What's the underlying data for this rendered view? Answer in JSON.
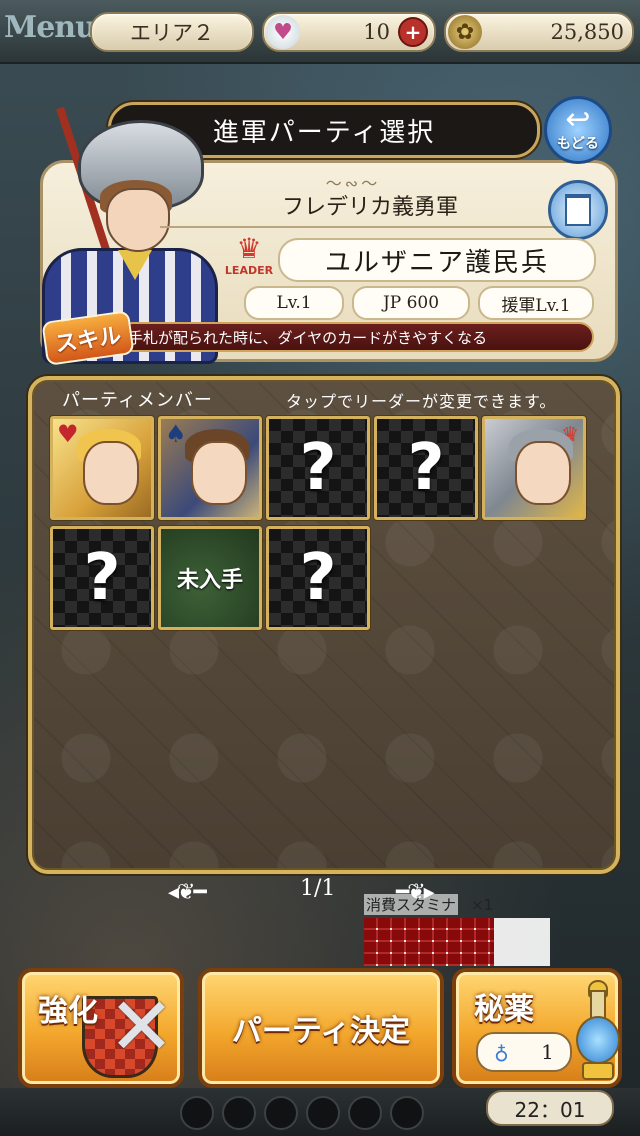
{
  "topbar": {
    "menu_label": "Menu",
    "area_label": "エリア２",
    "hearts_value": "10",
    "coins_value": "25,850"
  },
  "header": {
    "title": "進軍パーティ選択",
    "back_label": "もどる",
    "ornament": "～∾～",
    "party_name": "フレデリカ義勇軍",
    "leader_badge": "LEADER",
    "leader_name": "ユルザニア護民兵",
    "level": "Lv.1",
    "jp": "JP  600",
    "support_level": "援軍Lv.1",
    "skill_tag": "スキル",
    "skill_desc": "手札が配られた時に、ダイヤのカードがきやすくなる"
  },
  "members": {
    "heading": "パーティメンバー",
    "hint": "タップでリーダーが変更できます。",
    "slots": [
      {
        "type": "character",
        "suit": "♥"
      },
      {
        "type": "character",
        "suit": "♠"
      },
      {
        "type": "empty",
        "label": "?"
      },
      {
        "type": "empty",
        "label": "?"
      },
      {
        "type": "leader",
        "suit": "♛"
      },
      {
        "type": "empty",
        "label": "?"
      },
      {
        "type": "unowned",
        "label": "未入手"
      },
      {
        "type": "empty",
        "label": "?"
      }
    ]
  },
  "pager": {
    "page": "1/1"
  },
  "stamina": {
    "label": "消費スタミナ",
    "multiplier": "×1"
  },
  "buttons": {
    "enhance": "強化",
    "party_confirm": "パーティ決定",
    "potion": "秘薬",
    "potion_count": "1"
  },
  "timer": "22：01",
  "colors": {
    "accent_gold": "#d5b45f",
    "button_orange": "#f3a72c",
    "skill_red": "#6a1f1d"
  }
}
